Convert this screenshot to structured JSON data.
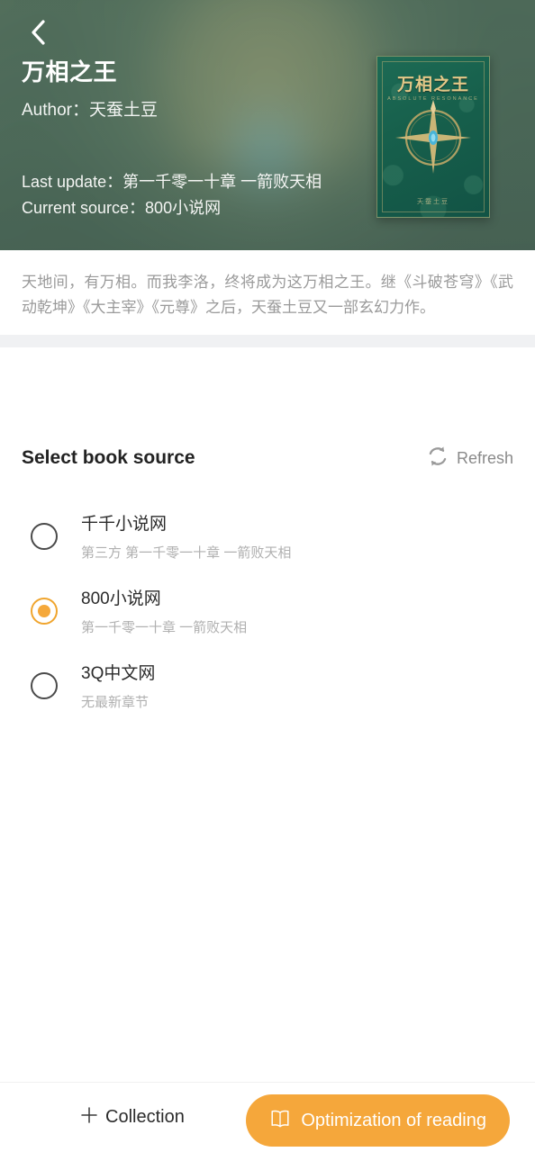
{
  "header": {
    "back_icon": "chevron-left-icon",
    "title": "万相之王",
    "author_label": "Author：天蚕土豆",
    "last_update_label": "Last update：第一千零一十章 一箭败天相",
    "current_source_label": "Current source：800小说网",
    "background_color": "#4c6759",
    "cover": {
      "title": "万相之王",
      "subtitle": "ABSOLUTE RESONANCE",
      "author": "天蚕土豆"
    }
  },
  "description": {
    "text": "天地间，有万相。而我李洛，终将成为这万相之王。继《斗破苍穹》《武动乾坤》《大主宰》《元尊》之后，天蚕土豆又一部玄幻力作。"
  },
  "source_section": {
    "title": "Select book source",
    "refresh_label": "Refresh",
    "refresh_icon": "refresh-icon",
    "selected_color": "#f5a83a",
    "items": [
      {
        "name": "千千小说网",
        "sub": "第三方 第一千零一十章 一箭败天相",
        "selected": false
      },
      {
        "name": "800小说网",
        "sub": "第一千零一十章 一箭败天相",
        "selected": true
      },
      {
        "name": "3Q中文网",
        "sub": "无最新章节",
        "selected": false
      }
    ]
  },
  "bottom_bar": {
    "collection_label": "Collection",
    "collection_icon": "plus-icon",
    "optimize_label": "Optimization of reading",
    "optimize_icon": "open-book-icon",
    "optimize_color": "#f5a73b"
  }
}
